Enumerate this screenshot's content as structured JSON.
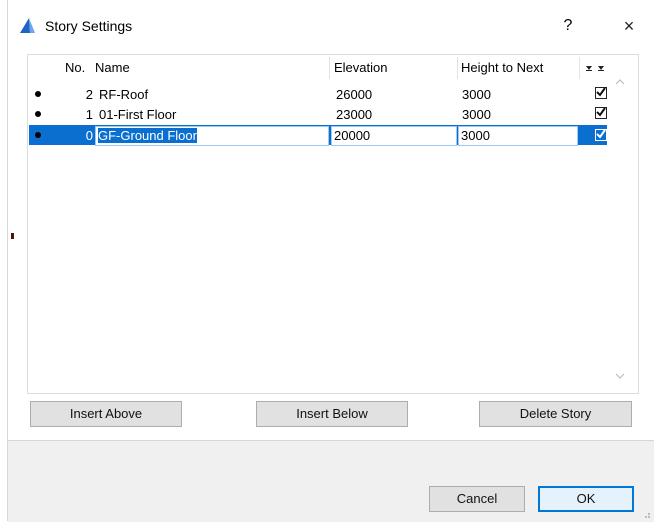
{
  "window": {
    "title": "Story Settings",
    "help_label": "?",
    "close_label": "×"
  },
  "table": {
    "headers": {
      "no": "No.",
      "name": "Name",
      "elevation": "Elevation",
      "height_to_next": "Height to Next"
    },
    "rows": [
      {
        "no": "2",
        "name": "RF-Roof",
        "elevation": "26000",
        "height_to_next": "3000",
        "checked": true,
        "selected": false
      },
      {
        "no": "1",
        "name": "01-First Floor",
        "elevation": "23000",
        "height_to_next": "3000",
        "checked": true,
        "selected": false
      },
      {
        "no": "0",
        "name": "GF-Ground Floor",
        "elevation": "20000",
        "height_to_next": "3000",
        "checked": true,
        "selected": true
      }
    ]
  },
  "buttons": {
    "insert_above": "Insert Above",
    "insert_below": "Insert Below",
    "delete_story": "Delete Story",
    "cancel": "Cancel",
    "ok": "OK"
  },
  "colors": {
    "selection": "#0b6fd0",
    "ok_border": "#0078d7"
  }
}
